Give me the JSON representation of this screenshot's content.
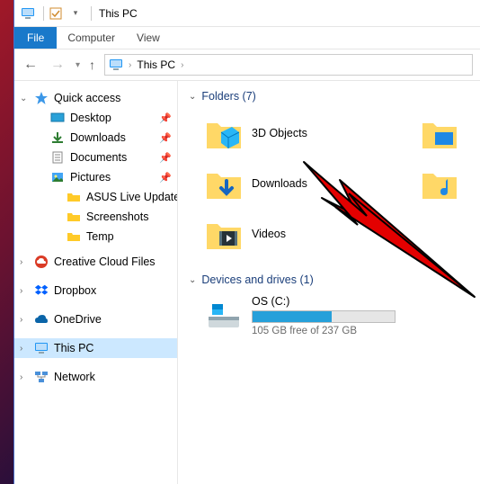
{
  "titlebar": {
    "title": "This PC"
  },
  "ribbon": {
    "file": "File",
    "computer": "Computer",
    "view": "View"
  },
  "breadcrumb": {
    "root": "This PC"
  },
  "sidebar": {
    "quick_access": "Quick access",
    "items": [
      {
        "label": "Desktop"
      },
      {
        "label": "Downloads"
      },
      {
        "label": "Documents"
      },
      {
        "label": "Pictures"
      },
      {
        "label": "ASUS Live Update"
      },
      {
        "label": "Screenshots"
      },
      {
        "label": "Temp"
      }
    ],
    "creative": "Creative Cloud Files",
    "dropbox": "Dropbox",
    "onedrive": "OneDrive",
    "thispc": "This PC",
    "network": "Network"
  },
  "sections": {
    "folders_label": "Folders (7)",
    "drives_label": "Devices and drives (1)"
  },
  "folders": {
    "f0": "3D Objects",
    "f1": "Downloads",
    "f2": "Videos"
  },
  "drive": {
    "name": "OS (C:)",
    "sub": "105 GB free of 237 GB",
    "used_pct": 56
  }
}
